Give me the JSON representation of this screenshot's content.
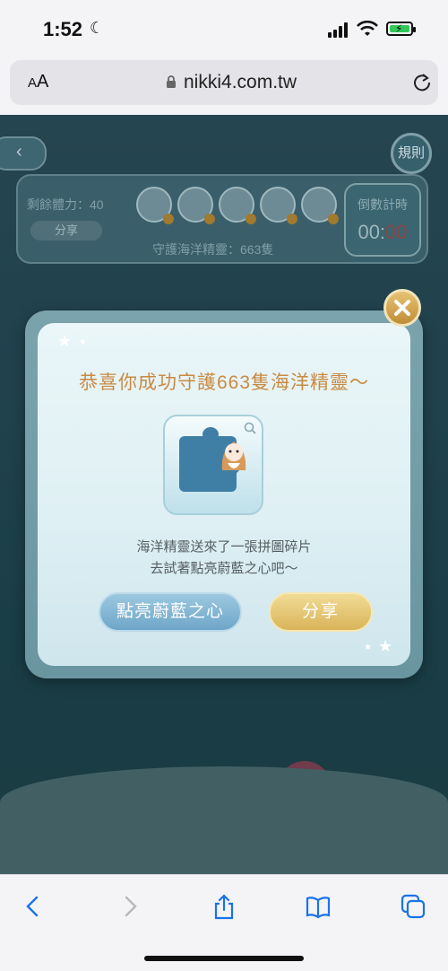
{
  "status_bar": {
    "time": "1:52",
    "moon_icon": "moon-icon",
    "signal_icon": "cellular-signal-icon",
    "wifi_icon": "wifi-icon",
    "battery_icon": "battery-charging-icon",
    "battery_color": "#34c759"
  },
  "browser": {
    "aa_label_small": "A",
    "aa_label": "A",
    "url": "nikki4.com.tw",
    "lock_icon": "lock-icon",
    "reload_icon": "reload-icon"
  },
  "game": {
    "back_label": "‹",
    "rules_label": "規則",
    "stamina_label": "剩餘體力：40",
    "share_small_label": "分享",
    "protect_count": "守護海洋精靈：663隻",
    "countdown_label": "倒數計時",
    "countdown_time_a": "00:",
    "countdown_time_b": "00",
    "creatures": [
      "seal-icon",
      "walrus-icon",
      "crab-icon",
      "starfish-icon",
      "penguin-icon"
    ]
  },
  "modal": {
    "title": "恭喜你成功守護663隻海洋精靈～",
    "message_line1": "海洋精靈送來了一張拼圖碎片",
    "message_line2": "去試著點亮蔚藍之心吧～",
    "light_button": "點亮蔚藍之心",
    "share_button": "分享",
    "close_icon": "close-icon",
    "accent_color": "#c98a42"
  },
  "toolbar": {
    "icons": [
      "back-arrow-icon",
      "forward-arrow-icon",
      "share-icon",
      "bookmarks-icon",
      "tabs-icon"
    ],
    "tint": "#1a73e8"
  }
}
